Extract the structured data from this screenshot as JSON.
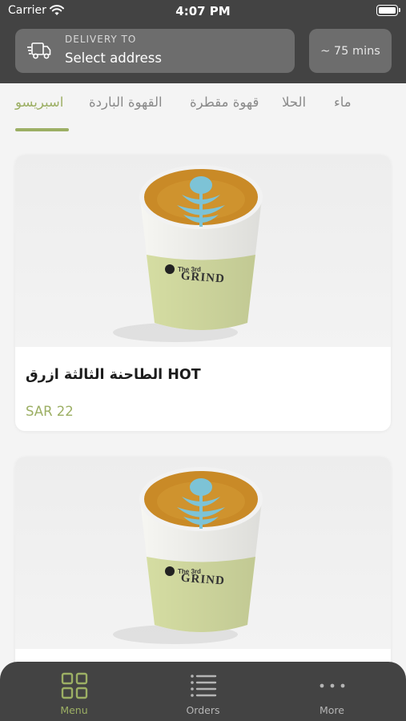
{
  "status_bar": {
    "carrier": "Carrier",
    "time": "4:07 PM"
  },
  "header": {
    "delivery_caption": "DELIVERY TO",
    "delivery_value": "Select address",
    "eta": "~ 75 mins"
  },
  "tabs": [
    {
      "label": "اسبريسو",
      "active": true
    },
    {
      "label": "القهوة الباردة",
      "active": false
    },
    {
      "label": "قهوة مقطرة",
      "active": false
    },
    {
      "label": "الحلا",
      "active": false
    },
    {
      "label": "ماء",
      "active": false
    }
  ],
  "products": [
    {
      "name": "الطاحنة الثالثة ازرق HOT",
      "price": "SAR 22",
      "image": "coffee-cup-photo",
      "cup_brand": "GRIND",
      "cup_brand_small": "The 3rd"
    },
    {
      "name": "",
      "price": "",
      "image": "coffee-cup-photo",
      "cup_brand": "GRIND",
      "cup_brand_small": "The 3rd"
    }
  ],
  "bottom_nav": [
    {
      "label": "Menu",
      "icon": "grid-icon",
      "active": true
    },
    {
      "label": "Orders",
      "icon": "list-icon",
      "active": false
    },
    {
      "label": "More",
      "icon": "more-dots-icon",
      "active": false
    }
  ],
  "colors": {
    "header_bg": "#434343",
    "accent": "#9caf64",
    "box_bg": "#6d6d6d",
    "cup_green": "#d6dea3",
    "latte_blue": "#7dc3d6"
  }
}
